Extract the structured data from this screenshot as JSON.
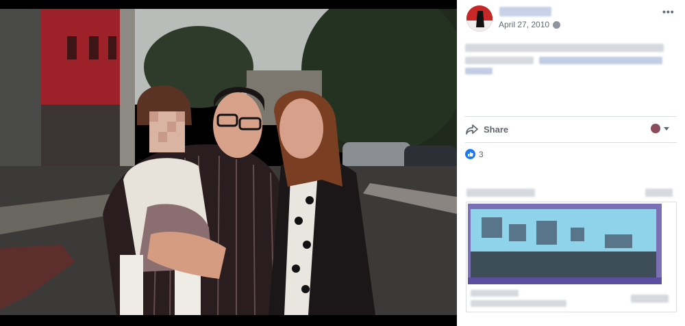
{
  "post": {
    "date": "April 27, 2010",
    "visibility_icon": "globe-icon",
    "more_icon": "more-options-icon",
    "more_label": "•••"
  },
  "actions": {
    "share_label": "Share",
    "share_icon": "share-arrow-icon"
  },
  "reactions": {
    "type": "like",
    "count": "3"
  },
  "colors": {
    "panel_bg": "#ffffff",
    "viewer_bg": "#000000",
    "like_blue": "#1877f2",
    "muted_text": "#606770"
  }
}
